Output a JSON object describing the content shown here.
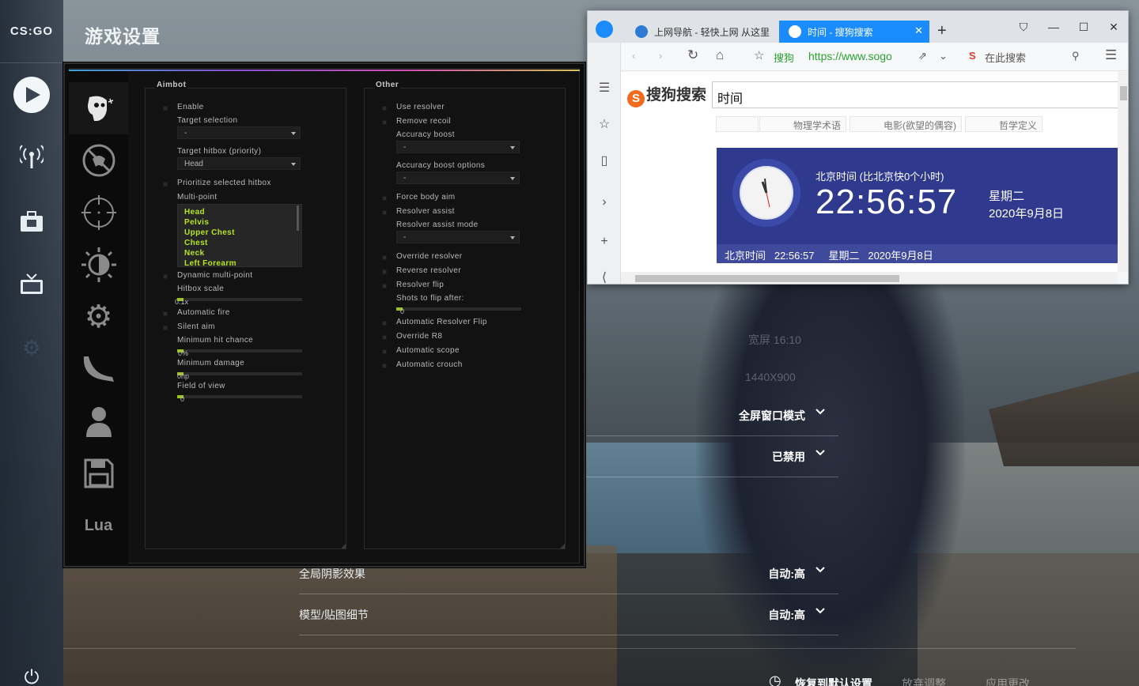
{
  "page": {
    "title": "游戏设置"
  },
  "rail": {
    "logo": "CS:GO"
  },
  "background_settings": {
    "ghost_rows": [
      "宽屏 16:10",
      "1440X900"
    ],
    "rows": [
      {
        "label": "",
        "value": "全屏窗口模式"
      },
      {
        "label": "",
        "value": "已禁用"
      },
      {
        "label": "全局阴影效果",
        "value": "自动:高"
      },
      {
        "label": "模型/贴图细节",
        "value": "自动:高"
      }
    ],
    "footer": {
      "reset": "恢复到默认设置",
      "discard": "放弃调整",
      "apply": "应用更改"
    }
  },
  "cheat_menu": {
    "tabs": [
      "aimbot",
      "anti-aim",
      "visuals-crosshair",
      "visuals-brightness",
      "misc",
      "skins",
      "players",
      "config",
      "Lua"
    ],
    "lua_label": "Lua",
    "aimbot": {
      "title": "Aimbot",
      "enable": "Enable",
      "target_selection_label": "Target selection",
      "target_selection_value": "-",
      "target_hitbox_label": "Target hitbox (priority)",
      "target_hitbox_value": "Head",
      "prioritize": "Prioritize selected hitbox",
      "multipoint_label": "Multi-point",
      "multipoint_items": [
        "Head",
        "Pelvis",
        "Upper Chest",
        "Chest",
        "Neck",
        "Left Forearm"
      ],
      "dynamic_multipoint": "Dynamic multi-point",
      "hitbox_scale_label": "Hitbox scale",
      "hitbox_scale_value": "0.1x",
      "automatic_fire": "Automatic fire",
      "silent_aim": "Silent aim",
      "min_hit_chance_label": "Minimum hit chance",
      "min_hit_chance_value": "0%",
      "min_damage_label": "Minimum damage",
      "min_damage_value": "0hp",
      "fov_label": "Field of view",
      "fov_value": "0"
    },
    "other": {
      "title": "Other",
      "use_resolver": "Use resolver",
      "remove_recoil": "Remove recoil",
      "accuracy_boost_label": "Accuracy boost",
      "accuracy_boost_value": "-",
      "accuracy_boost_options_label": "Accuracy boost options",
      "accuracy_boost_options_value": "-",
      "force_body_aim": "Force body aim",
      "resolver_assist": "Resolver assist",
      "resolver_assist_mode_label": "Resolver assist mode",
      "resolver_assist_mode_value": "-",
      "override_resolver": "Override resolver",
      "reverse_resolver": "Reverse resolver",
      "resolver_flip": "Resolver flip",
      "shots_to_flip_label": "Shots to flip after:",
      "shots_to_flip_value": "0",
      "auto_resolver_flip": "Automatic Resolver Flip",
      "override_r8": "Override R8",
      "automatic_scope": "Automatic scope",
      "automatic_crouch": "Automatic crouch"
    }
  },
  "browser": {
    "tabs": [
      {
        "label": "上网导航 - 轻快上网 从这里",
        "active": false
      },
      {
        "label": "时间 - 搜狗搜索",
        "active": true
      }
    ],
    "sougou_label": "搜狗",
    "url": "https://www.sogo",
    "search_here": "在此搜索",
    "site_logo": "搜狗搜索",
    "search_query": "时间",
    "chips": [
      "物理学术语",
      "电影(欲望的偶容)",
      "哲学定义"
    ],
    "clock": {
      "caption": "北京时间 (比北京快0个小时)",
      "time": "22:56:57",
      "weekday": "星期二",
      "date": "2020年9月8日",
      "bar_text": "北京时间   22:56:57     星期二   2020年9月8日"
    }
  }
}
